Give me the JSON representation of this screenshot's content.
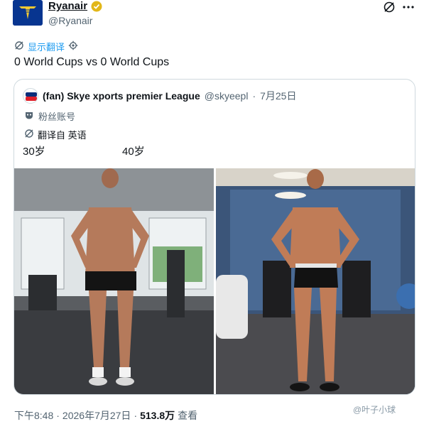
{
  "tweet": {
    "display_name": "Ryanair",
    "handle": "@Ryanair",
    "verified": true,
    "translate_label": "显示翻译",
    "text": "0 World Cups vs 0 World Cups"
  },
  "icons": {
    "verified": "verified-badge-icon",
    "grok": "grok-icon",
    "more": "more-icon",
    "translate": "translate-icon",
    "settings": "gear-icon",
    "fan_account": "mask-icon"
  },
  "quote": {
    "display_name": "(fan) Skye xports premier League",
    "handle": "@skyeepl",
    "separator": "·",
    "date": "7月25日",
    "account_label": "粉丝账号",
    "translated_from": "翻译自 英语",
    "left_caption": "30岁",
    "right_caption": "40岁"
  },
  "footer": {
    "time": "下午8:48",
    "dot1": "·",
    "date": "2026年7月27日",
    "dot2": "·",
    "views": "513.8万",
    "views_label": "查看"
  },
  "watermark": "@叶子小球",
  "colors": {
    "accent": "#1d9bf0",
    "brand_blue": "#073590",
    "brand_yellow": "#f1c933",
    "verified_gold": "#e2b719"
  }
}
